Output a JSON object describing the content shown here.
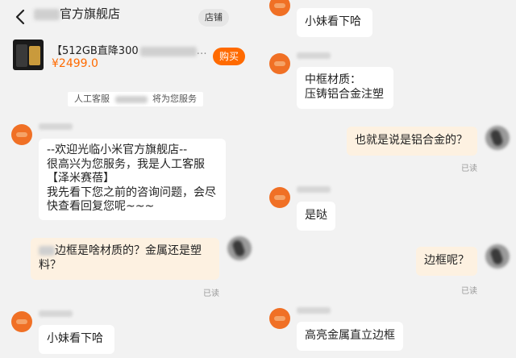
{
  "left": {
    "header": {
      "store_title": "官方旗舰店",
      "store_button": "店铺"
    },
    "product": {
      "title_prefix": "【512GB直降300",
      "price": "¥2499.0",
      "buy_button": "购买"
    },
    "service_notice": {
      "prefix": "人工客服",
      "suffix": "将为您服务"
    },
    "messages": [
      {
        "sender": "agent",
        "text": "--欢迎光临小米官方旗舰店--\n很高兴为您服务，我是人工客服【泽米赛蓓】\n我先看下您之前的咨询问题，会尽快查看回复您呢~~~"
      },
      {
        "sender": "user",
        "text_suffix": "边框是啥材质的？金属还是塑料？",
        "status": "已读"
      },
      {
        "sender": "agent",
        "text": "小妹看下哈"
      }
    ]
  },
  "right": {
    "messages": [
      {
        "sender": "agent",
        "text": "小妹看下哈"
      },
      {
        "sender": "agent",
        "text": "中框材质：\n压铸铝合金注塑"
      },
      {
        "sender": "user",
        "text": "也就是说是铝合金的？",
        "status": "已读"
      },
      {
        "sender": "agent",
        "text": "是哒"
      },
      {
        "sender": "user",
        "text": "边框呢？",
        "status": "已读"
      },
      {
        "sender": "agent",
        "text": "高亮金属直立边框"
      }
    ]
  },
  "icons": {
    "back": "chevron-left-icon"
  },
  "colors": {
    "accent": "#ff6a00",
    "avatar": "#f07025",
    "user_bubble": "#fdf1e1",
    "background": "#f2f2f2"
  }
}
